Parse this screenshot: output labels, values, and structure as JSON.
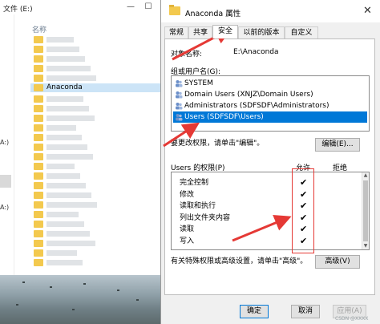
{
  "explorer": {
    "path_fragment": "文件 (E:)",
    "column_header": "名称",
    "selected_folder": "Anaconda",
    "left_labels": [
      "A:)",
      "A:)"
    ]
  },
  "dialog": {
    "title": "Anaconda 属性",
    "tabs": [
      "常规",
      "共享",
      "安全",
      "以前的版本",
      "自定义"
    ],
    "active_tab": "安全",
    "object_label": "对象名称:",
    "object_value": "E:\\Anaconda",
    "group_label": "组或用户名(G):",
    "users": [
      {
        "label": "SYSTEM"
      },
      {
        "label": "Domain Users (XNJZ\\Domain Users)"
      },
      {
        "label": "Administrators (SDFSDF\\Administrators)"
      },
      {
        "label": "Users (SDFSDF\\Users)"
      }
    ],
    "selected_user": "Users (SDFSDF\\Users)",
    "change_hint": "要更改权限，请单击\"编辑\"。",
    "edit_button": "编辑(E)...",
    "permissions_label": "Users 的权限(P)",
    "allow_header": "允许",
    "deny_header": "拒绝",
    "permissions": [
      {
        "name": "完全控制",
        "allow": "✔"
      },
      {
        "name": "修改",
        "allow": "✔"
      },
      {
        "name": "读取和执行",
        "allow": "✔"
      },
      {
        "name": "列出文件夹内容",
        "allow": "✔"
      },
      {
        "name": "读取",
        "allow": "✔"
      },
      {
        "name": "写入",
        "allow": "✔"
      }
    ],
    "advanced_hint": "有关特殊权限或高级设置，请单击\"高级\"。",
    "advanced_button": "高级(V)",
    "ok_button": "确定",
    "cancel_button": "取消",
    "apply_button": "应用(A)"
  },
  "colors": {
    "selection_blue": "#0078d7",
    "annotation_red": "#e53935",
    "folder_yellow": "#f3c94e"
  },
  "icons": {
    "close": "close-icon",
    "folder": "folder-icon",
    "user": "user-group-icon",
    "check": "checkmark-icon"
  },
  "watermark": "CSDN @XXXX"
}
